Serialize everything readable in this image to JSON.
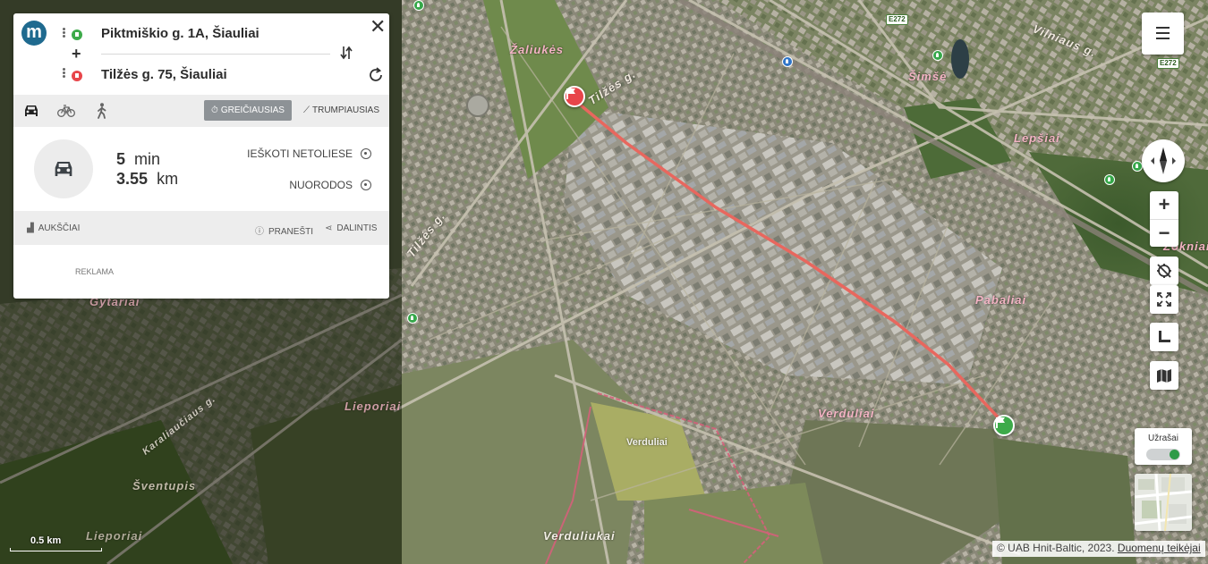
{
  "route": {
    "from": "Piktmiškio g. 1A, Šiauliai",
    "to": "Tilžės g. 75, Šiauliai",
    "duration_value": "5",
    "duration_unit": "min",
    "distance_value": "3.55",
    "distance_unit": "km"
  },
  "modes": {
    "fastest_label": "GREIČIAUSIAS",
    "shortest_label": "TRUMPIAUSIAS",
    "active": "fastest"
  },
  "actions": {
    "search_nearby": "IEŠKOTI NETOLIESE",
    "directions": "NUORODOS",
    "elevation": "AUKŠČIAI",
    "report": "PRANEŠTI",
    "share": "DALINTIS",
    "ad": "REKLAMA"
  },
  "map_labels": {
    "zaliukes": "Žaliukės",
    "tilzes_road_top": "Tilžės g.",
    "tilzes_road_left": "Tilžės g.",
    "vilniaus_g": "Vilniaus g.",
    "simse": "Šimšė",
    "lepsiai": "Lepšiai",
    "zokniai": "Zokniai",
    "pabaliai": "Pabaliai",
    "gytariai": "Gytariai",
    "lieporiai": "Lieporiai",
    "lieporiai_bottom": "Lieporiai",
    "verduliai": "Verduliai",
    "verduliai_field": "Verduliai",
    "verduliukai": "Verduliukai",
    "sventupis": "Šventupis",
    "karaliaucius": "Karaliaučiaus g.",
    "e272_a": "E272",
    "e272_b": "E272"
  },
  "map": {
    "labels_toggle_label": "Užrašai",
    "labels_on": true,
    "scale_label": "0.5 km",
    "attribution": "© UAB Hnit-Baltic, 2023.",
    "attribution_link": "Duomenų teikėjai",
    "route_color": "#e8675e",
    "accent": "#1f6a8f"
  },
  "icons": [
    "logo-icon",
    "close-icon",
    "swap-icon",
    "reverse-icon",
    "car-icon",
    "bike-icon",
    "walk-icon",
    "menu-icon",
    "compass-icon",
    "zoom-in-icon",
    "zoom-out-icon",
    "no-location-icon",
    "fullscreen-icon",
    "ruler-icon",
    "map-layers-icon"
  ]
}
